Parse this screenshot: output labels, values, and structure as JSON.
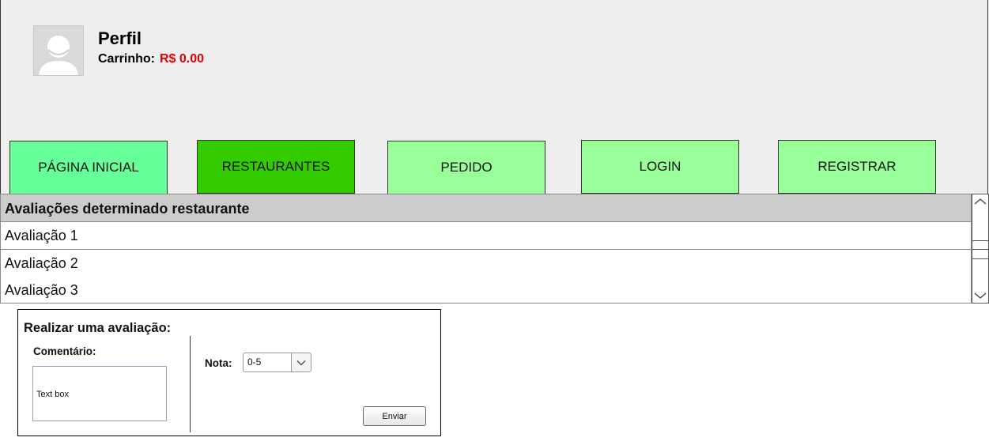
{
  "profile": {
    "name": "Perfil",
    "cart_label": "Carrinho:",
    "cart_value": "R$ 0.00",
    "avatar_icon": "user-avatar-icon"
  },
  "nav": {
    "home": "PÁGINA INICIAL",
    "restaurants": "RESTAURANTES",
    "order": "PEDIDO",
    "login": "LOGIN",
    "register": "REGISTRAR",
    "active": "restaurants"
  },
  "reviews": {
    "header": "Avaliações determinado restaurante",
    "items": [
      "Avaliação 1",
      "Avaliação 2",
      "Avaliação 3"
    ]
  },
  "form": {
    "title": "Realizar uma avaliação:",
    "comment_label": "Comentário:",
    "comment_value": "Text box",
    "nota_label": "Nota:",
    "nota_value": "0-5",
    "submit": "Enviar"
  },
  "colors": {
    "header_bg": "#eeeeee",
    "nav_home": "#66ff99",
    "nav_active": "#33cc00",
    "nav_default": "#99ff99",
    "cart_value": "#e00000",
    "table_header": "#cccccc"
  }
}
